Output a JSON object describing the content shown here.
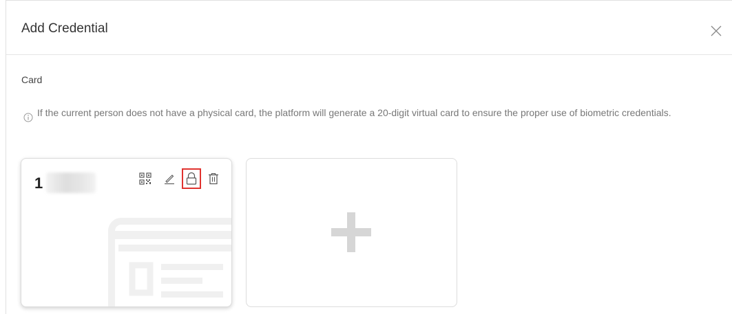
{
  "dialog": {
    "title": "Add Credential"
  },
  "section": {
    "label": "Card",
    "hint": "If the current person does not have a physical card, the platform will generate a 20-digit virtual card to ensure the proper use of biometric credentials."
  },
  "card": {
    "number_prefix": "1"
  },
  "icons": {
    "close": "close-icon",
    "info": "info-icon",
    "qr": "qr-code-icon",
    "edit": "pencil-icon",
    "lock": "lock-icon",
    "delete": "trash-icon",
    "add": "plus-icon"
  },
  "colors": {
    "highlight": "#e0322e"
  }
}
